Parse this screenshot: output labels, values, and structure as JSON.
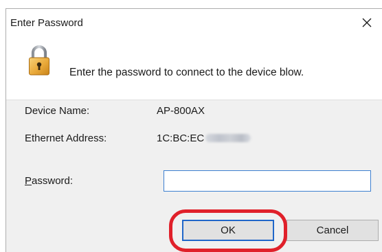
{
  "dialog": {
    "title": "Enter Password",
    "close_icon": "close-icon",
    "message": "Enter the password to connect to the device blow.",
    "lock_icon": "padlock-icon"
  },
  "fields": {
    "device_name_label": "Device Name:",
    "device_name_value": "AP-800AX",
    "ethernet_address_label": "Ethernet Address:",
    "ethernet_address_value": "1C:BC:EC",
    "password_label_mnemonic": "P",
    "password_label_rest": "assword:",
    "password_value": ""
  },
  "buttons": {
    "ok_label": "OK",
    "cancel_label": "Cancel"
  },
  "colors": {
    "dialog_background": "#f0f0f0",
    "focus_accent": "#1f66c9",
    "annotation_ring": "#e0202a"
  }
}
